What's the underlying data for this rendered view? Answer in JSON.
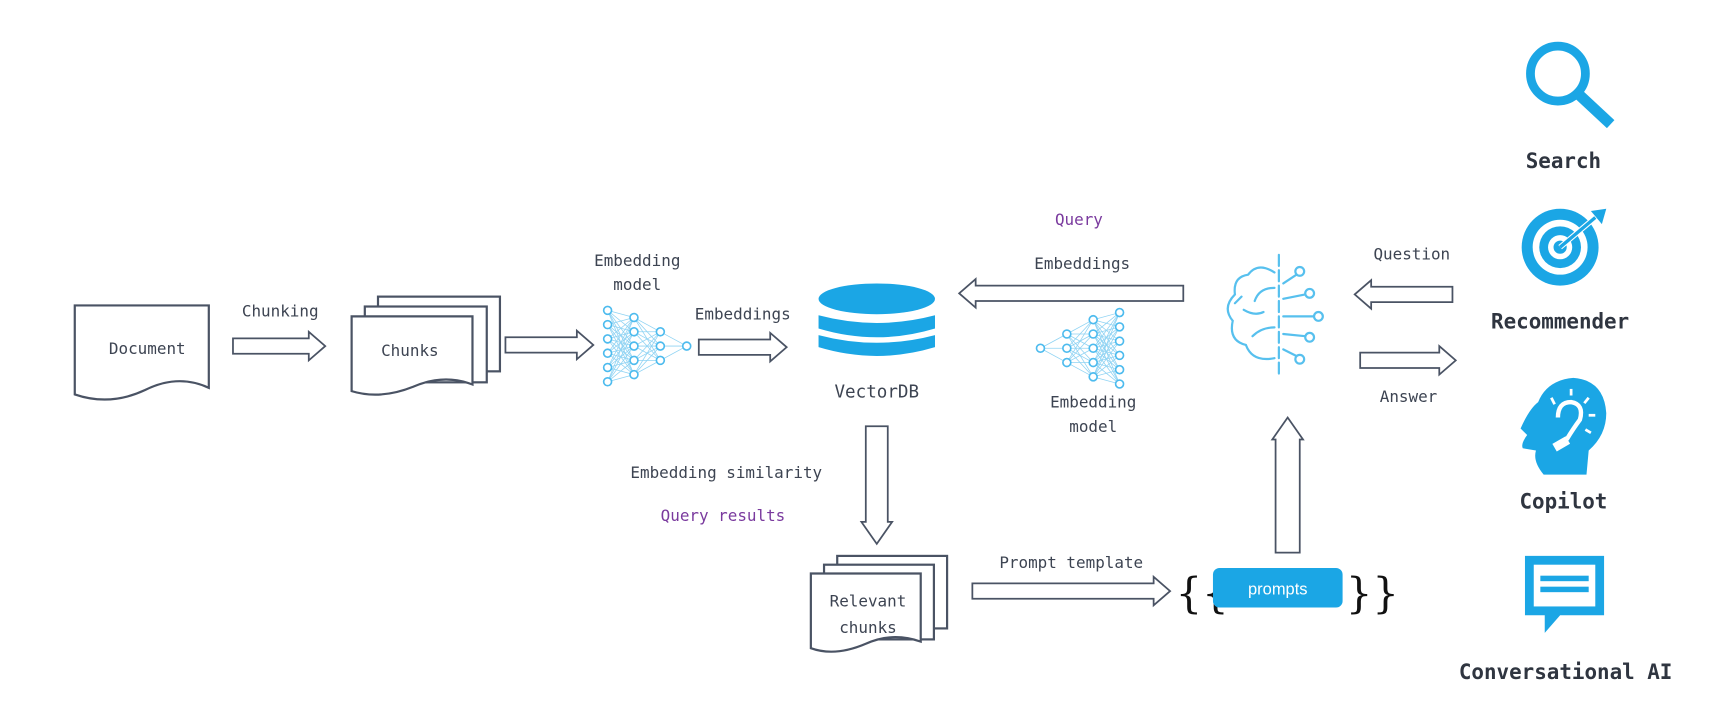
{
  "colors": {
    "accent": "#1ba6e5",
    "outline": "#4a5364",
    "highlight_text": "#7a3a9e"
  },
  "pipeline": {
    "document": "Document",
    "chunking": "Chunking",
    "chunks": "Chunks",
    "embedding_model_left": [
      "Embedding",
      "model"
    ],
    "embeddings_left": "Embeddings",
    "vectordb": "VectorDB",
    "query": "Query",
    "embeddings_right": "Embeddings",
    "embedding_model_right": [
      "Embedding",
      "model"
    ],
    "question": "Question",
    "answer": "Answer",
    "embedding_similarity": "Embedding similarity",
    "query_results": "Query results",
    "relevant_chunks": [
      "Relevant",
      "chunks"
    ],
    "prompt_template": "Prompt template",
    "prompts": "prompts",
    "brace_open": "{{",
    "brace_close": "}}"
  },
  "applications": [
    {
      "label": "Search",
      "icon": "search-icon"
    },
    {
      "label": "Recommender",
      "icon": "target-icon"
    },
    {
      "label": "Copilot",
      "icon": "idea-head-icon"
    },
    {
      "label": "Conversational AI",
      "icon": "chat-bubble-icon"
    }
  ]
}
